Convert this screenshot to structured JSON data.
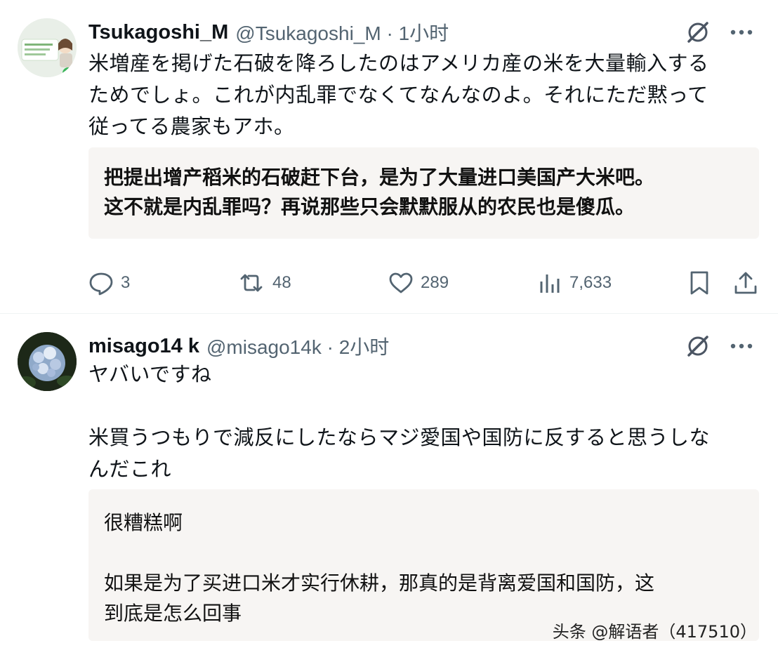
{
  "posts": [
    {
      "display_name": "Tsukagoshi_M",
      "handle_meta": "@Tsukagoshi_M · 1小时",
      "text": "米増産を掲げた石破を降ろしたのはアメリカ産の米を大量輸入する\nためでしょ。これが内乱罪でなくてなんなのよ。それにただ黙って\n従ってる農家もアホ。",
      "translation": "把提出增产稻米的石破赶下台，是为了大量进口美国产大米吧。\n这不就是内乱罪吗？再说那些只会默默服从的农民也是傻瓜。",
      "actions": {
        "replies": "3",
        "reposts": "48",
        "likes": "289",
        "views": "7,633"
      }
    },
    {
      "display_name": "misago14 k",
      "handle_meta": "@misago14k · 2小时",
      "text": "ヤバいですね\n\n米買うつもりで減反にしたならマジ愛国や国防に反すると思うしな\nんだこれ",
      "translation": "很糟糕啊\n\n如果是为了买进口米才实行休耕，那真的是背离爱国和国防，这\n到底是怎么回事"
    }
  ],
  "watermark": "头条 @解语者（417510）",
  "colors": {
    "text_primary": "#0f1419",
    "text_secondary": "#536471",
    "translation_bg": "#f7f5f3",
    "divider": "#eff3f4"
  },
  "icons": [
    "grok-icon",
    "more-icon",
    "reply-icon",
    "repost-icon",
    "like-icon",
    "views-icon",
    "bookmark-icon",
    "share-icon"
  ]
}
